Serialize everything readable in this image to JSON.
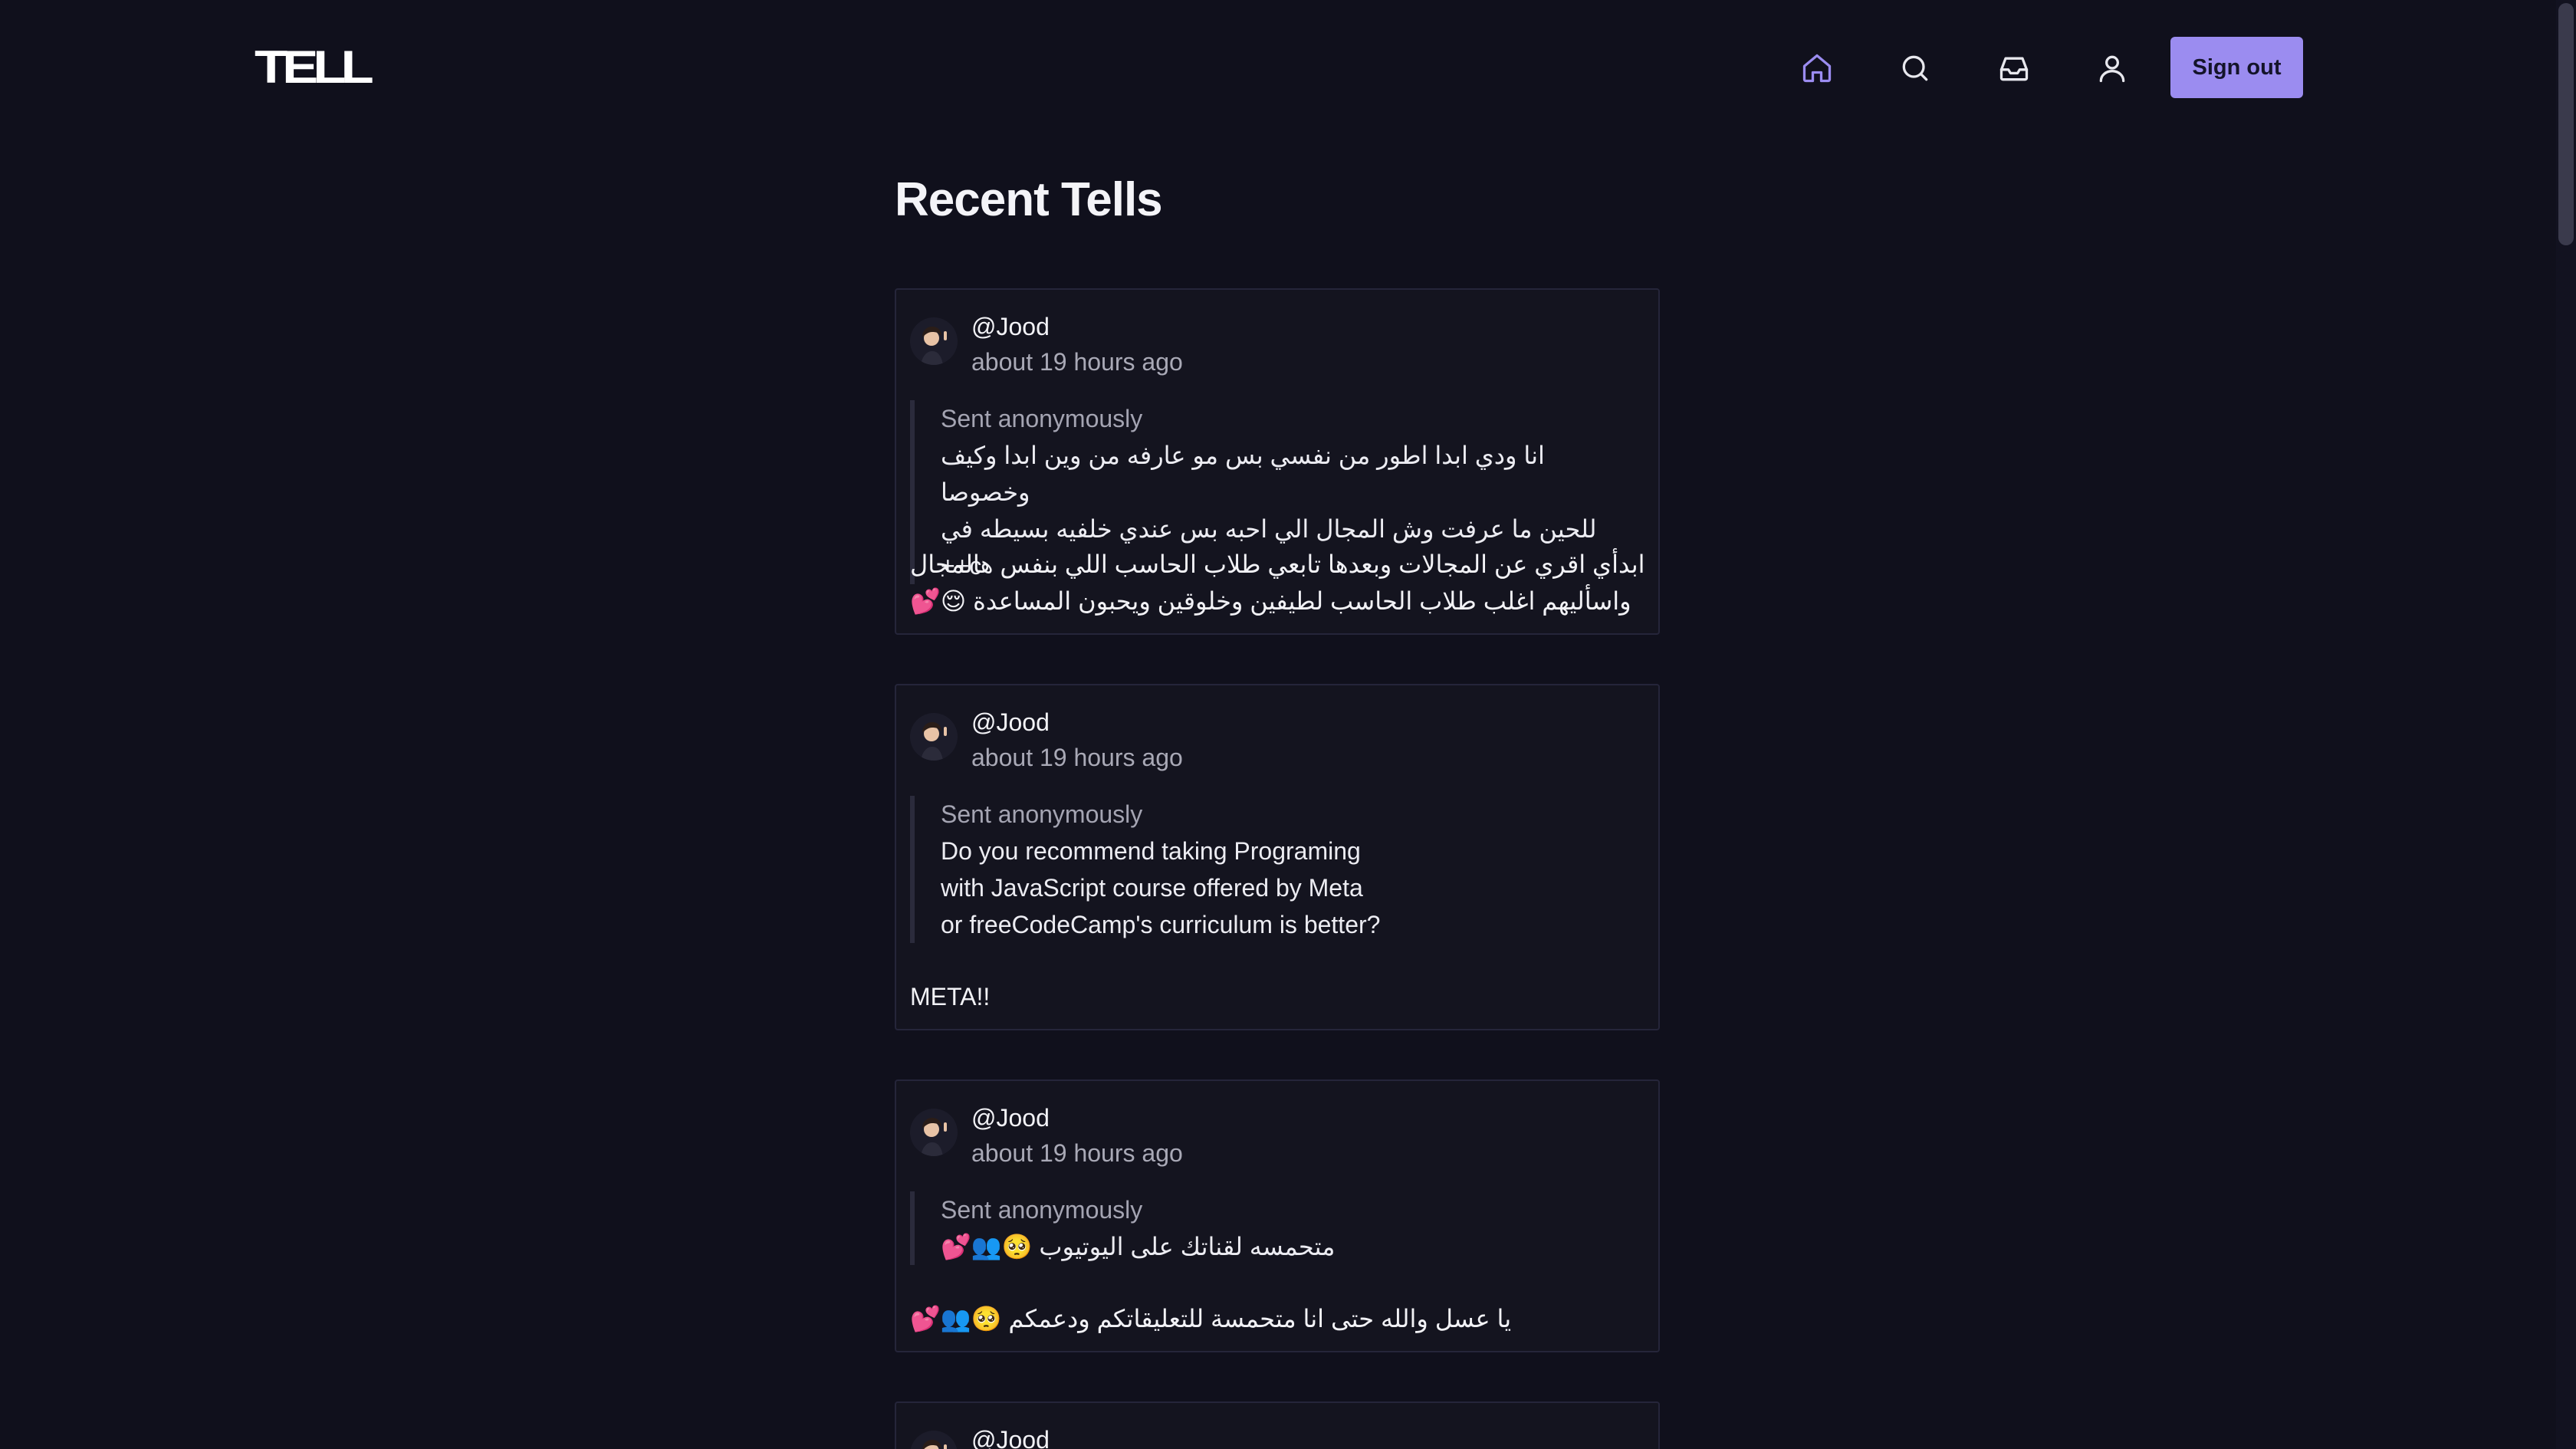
{
  "header": {
    "logo": "TELL",
    "signout_label": "Sign out",
    "nav": [
      {
        "icon": "home-icon"
      },
      {
        "icon": "search-icon"
      },
      {
        "icon": "inbox-icon"
      },
      {
        "icon": "user-icon"
      }
    ]
  },
  "main": {
    "title": "Recent Tells",
    "tells": [
      {
        "username": "@Jood",
        "time": "about 19 hours ago",
        "anon_label": "Sent anonymously",
        "question": "انا ودي ابدا اطور من نفسي بس مو عارفه من وين ابدا وكيف وخصوصا\nللحين ما عرفت وش المجال الي احبه بس عندي خلفيه بسيطه في c++",
        "answer": "ابدأي اقري عن المجالات وبعدها تابعي طلاب الحاسب اللي بنفس هالمجال\nواسأليهم اغلب طلاب الحاسب لطيفين وخلوقين ويحبون المساعدة 😌💕"
      },
      {
        "username": "@Jood",
        "time": "about 19 hours ago",
        "anon_label": "Sent anonymously",
        "question": "Do you recommend taking Programing\nwith JavaScript course offered by Meta\nor freeCodeCamp's curriculum is better?",
        "answer": "META!!"
      },
      {
        "username": "@Jood",
        "time": "about 19 hours ago",
        "anon_label": "Sent anonymously",
        "question": "متحمسه لقناتك على اليوتيوب 🥺👥💕",
        "answer": "يا عسل والله حتى انا متحمسة للتعليقاتكم ودعمكم 🥺👥💕"
      },
      {
        "username": "@Jood"
      }
    ]
  },
  "colors": {
    "background": "#10101c",
    "card": "#14141f",
    "accent": "#9b8cf0",
    "active_nav": "#9b8cf0"
  }
}
